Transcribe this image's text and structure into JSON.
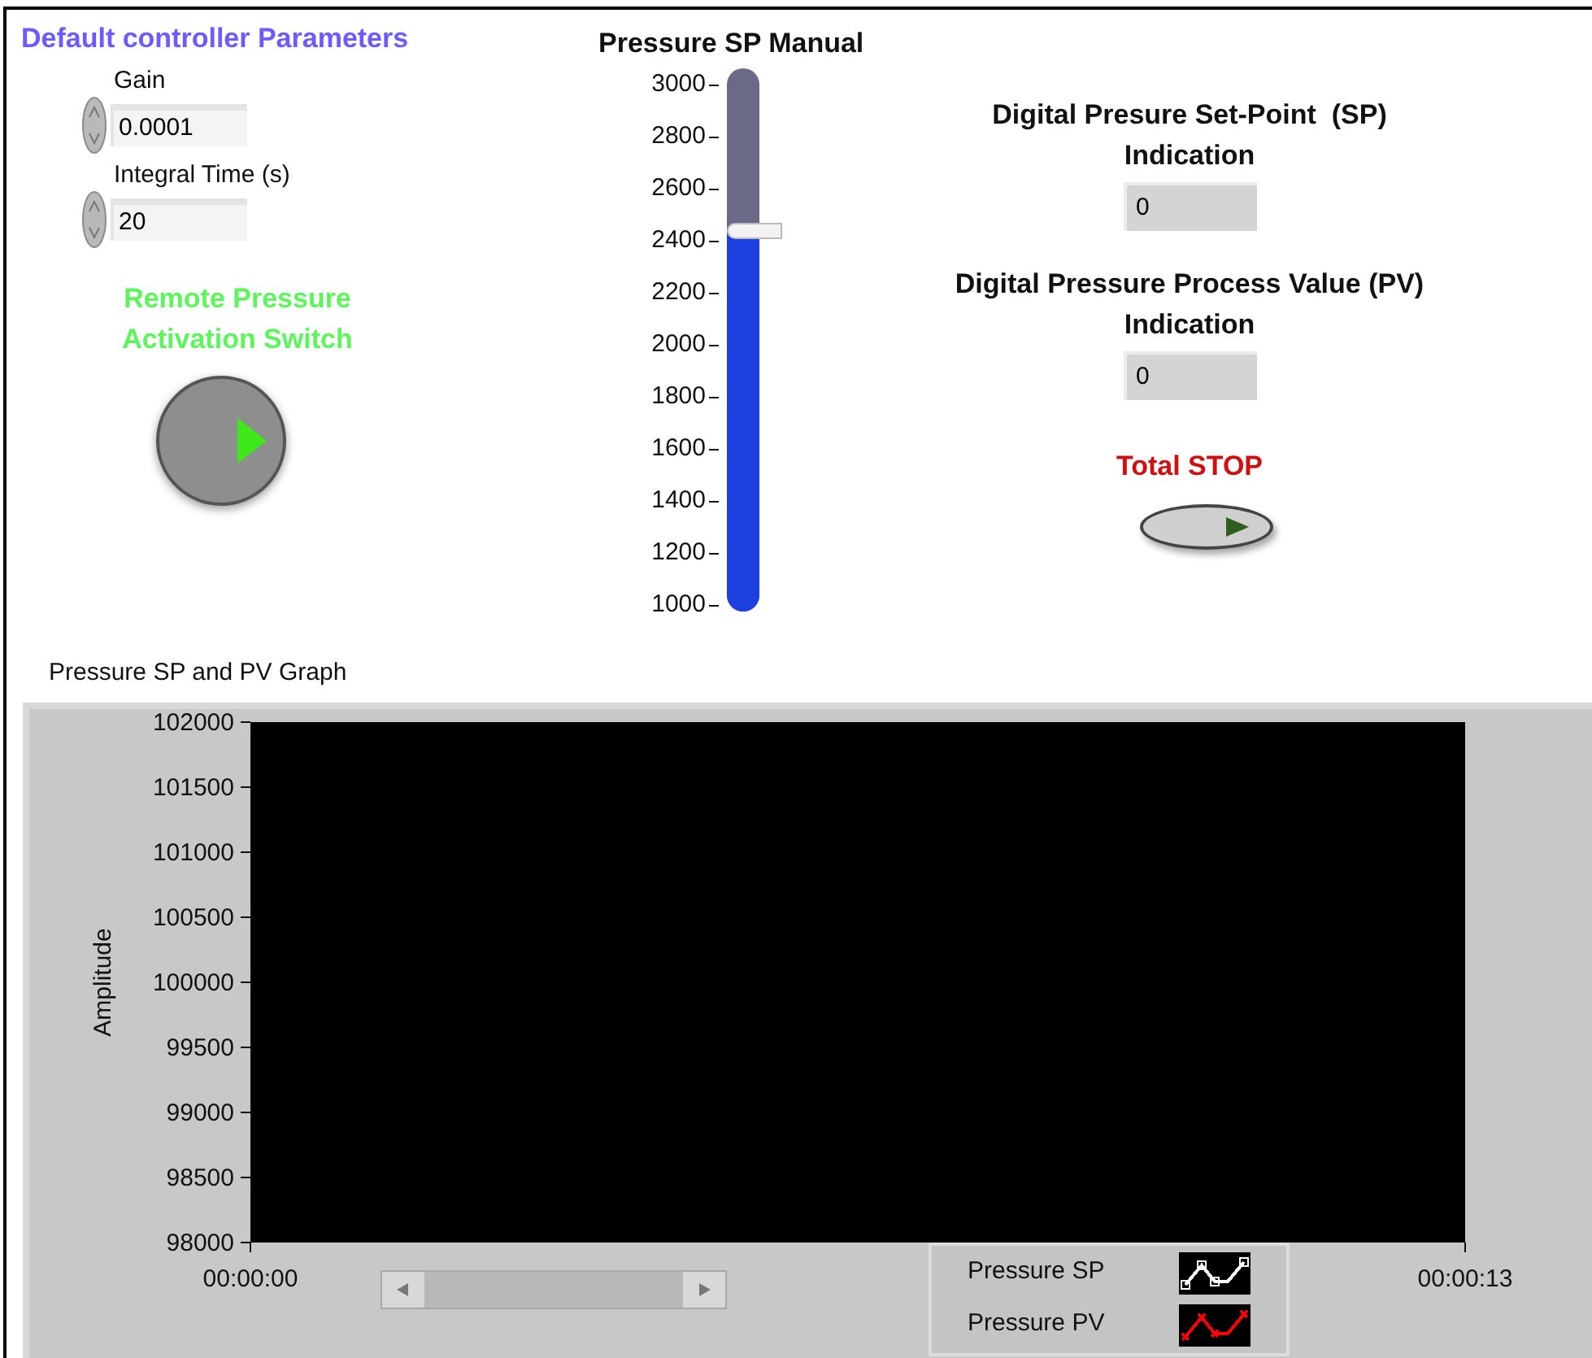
{
  "controller": {
    "title": "Default controller Parameters",
    "fields": [
      {
        "label": "Gain",
        "value": "0.0001"
      },
      {
        "label": "Integral Time (s)",
        "value": "20"
      }
    ]
  },
  "remote_switch": {
    "label": "Remote Pressure Activation Switch",
    "on": false
  },
  "slider": {
    "title": "Pressure SP Manual",
    "ticks": [
      "3000",
      "2800",
      "2600",
      "2400",
      "2200",
      "2000",
      "1800",
      "1600",
      "1400",
      "1200",
      "1000"
    ],
    "level": 0.7
  },
  "indicators": [
    {
      "label": "Digital Presure Set-Point  (SP) Indication",
      "value": "0"
    },
    {
      "label": "Digital Pressure Process Value (PV) Indication",
      "value": "0"
    }
  ],
  "stop_button": {
    "label": "Total STOP",
    "on": false
  },
  "graph": {
    "title": "Pressure SP and PV Graph",
    "y_axis_label": "Amplitude",
    "y_tick_labels": [
      "102000",
      "101500",
      "101000",
      "100500",
      "100000",
      "99500",
      "99000",
      "98500",
      "98000"
    ],
    "x_tick_labels": [
      "00:00:00",
      "00:00:13"
    ],
    "legend": [
      {
        "name": "Pressure SP",
        "color": "#ffffff",
        "kind": "squares"
      },
      {
        "name": "Pressure PV",
        "color": "#ff0000",
        "kind": "crosses"
      }
    ]
  }
}
